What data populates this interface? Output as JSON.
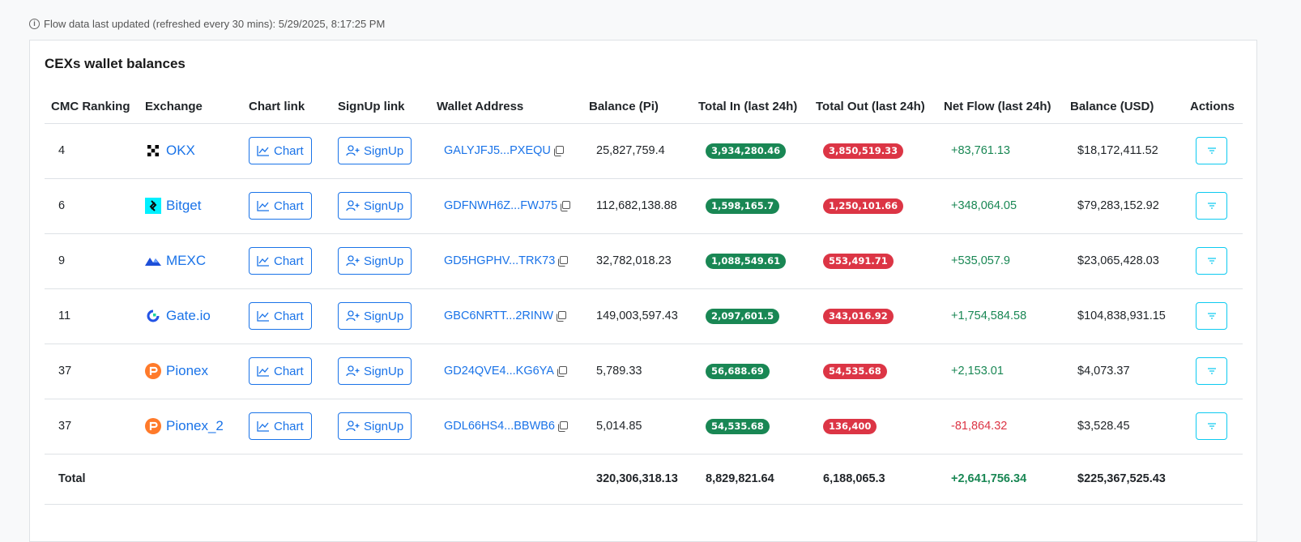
{
  "status": {
    "info_icon": "info-circle-icon",
    "updated_text": "Flow data last updated (refreshed every 30 mins): 5/29/2025, 8:17:25 PM"
  },
  "card": {
    "title": "CEXs wallet balances"
  },
  "columns": [
    "CMC Ranking",
    "Exchange",
    "Chart link",
    "SignUp link",
    "Wallet Address",
    "Balance (Pi)",
    "Total In (last 24h)",
    "Total Out (last 24h)",
    "Net Flow (last 24h)",
    "Balance (USD)",
    "Actions"
  ],
  "colors": {
    "link": "#1a73e8",
    "positive": "#198754",
    "negative": "#dc3545",
    "action_border": "#0dcaf0"
  },
  "rows": [
    {
      "rank": "4",
      "exchange": "OKX",
      "logo": "okx-logo-icon",
      "chart_label": "Chart",
      "signup_label": "SignUp",
      "wallet": "GALYJFJ5...PXEQU",
      "balance_pi": "25,827,759.4",
      "total_in": "3,934,280.46",
      "total_out": "3,850,519.33",
      "net_flow": "+83,761.13",
      "net_sign": "pos",
      "balance_usd": "$18,172,411.52"
    },
    {
      "rank": "6",
      "exchange": "Bitget",
      "logo": "bitget-logo-icon",
      "chart_label": "Chart",
      "signup_label": "SignUp",
      "wallet": "GDFNWH6Z...FWJ75",
      "balance_pi": "112,682,138.88",
      "total_in": "1,598,165.7",
      "total_out": "1,250,101.66",
      "net_flow": "+348,064.05",
      "net_sign": "pos",
      "balance_usd": "$79,283,152.92"
    },
    {
      "rank": "9",
      "exchange": "MEXC",
      "logo": "mexc-logo-icon",
      "chart_label": "Chart",
      "signup_label": "SignUp",
      "wallet": "GD5HGPHV...TRK73",
      "balance_pi": "32,782,018.23",
      "total_in": "1,088,549.61",
      "total_out": "553,491.71",
      "net_flow": "+535,057.9",
      "net_sign": "pos",
      "balance_usd": "$23,065,428.03"
    },
    {
      "rank": "11",
      "exchange": "Gate.io",
      "logo": "gateio-logo-icon",
      "chart_label": "Chart",
      "signup_label": "SignUp",
      "wallet": "GBC6NRTT...2RINW",
      "balance_pi": "149,003,597.43",
      "total_in": "2,097,601.5",
      "total_out": "343,016.92",
      "net_flow": "+1,754,584.58",
      "net_sign": "pos",
      "balance_usd": "$104,838,931.15"
    },
    {
      "rank": "37",
      "exchange": "Pionex",
      "logo": "pionex-logo-icon",
      "chart_label": "Chart",
      "signup_label": "SignUp",
      "wallet": "GD24QVE4...KG6YA",
      "balance_pi": "5,789.33",
      "total_in": "56,688.69",
      "total_out": "54,535.68",
      "net_flow": "+2,153.01",
      "net_sign": "pos",
      "balance_usd": "$4,073.37"
    },
    {
      "rank": "37",
      "exchange": "Pionex_2",
      "logo": "pionex-logo-icon",
      "chart_label": "Chart",
      "signup_label": "SignUp",
      "wallet": "GDL66HS4...BBWB6",
      "balance_pi": "5,014.85",
      "total_in": "54,535.68",
      "total_out": "136,400",
      "net_flow": "-81,864.32",
      "net_sign": "neg",
      "balance_usd": "$3,528.45"
    }
  ],
  "totals": {
    "label": "Total",
    "balance_pi": "320,306,318.13",
    "total_in": "8,829,821.64",
    "total_out": "6,188,065.3",
    "net_flow": "+2,641,756.34",
    "balance_usd": "$225,367,525.43"
  }
}
